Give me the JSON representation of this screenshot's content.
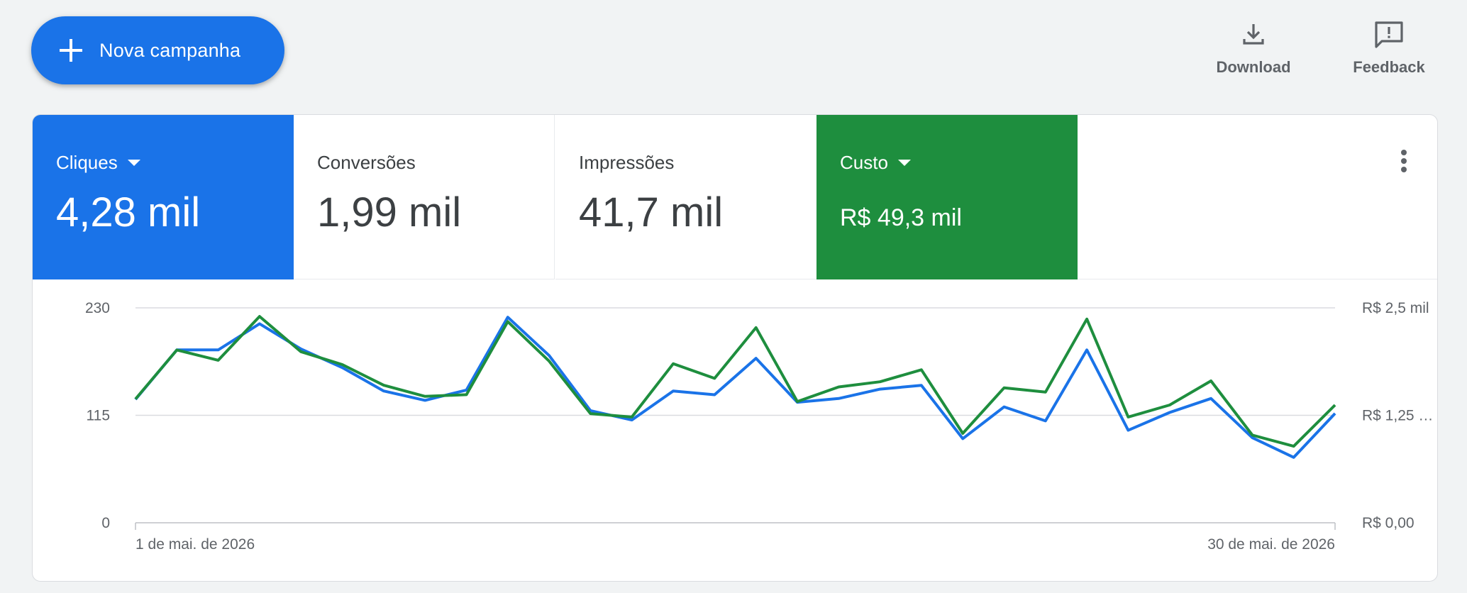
{
  "toolbar": {
    "new_campaign_label": "Nova campanha",
    "download_label": "Download",
    "feedback_label": "Feedback"
  },
  "metrics": [
    {
      "name": "Cliques",
      "value": "4,28 mil",
      "selected": true,
      "color": "#1a73e8"
    },
    {
      "name": "Conversões",
      "value": "1,99 mil",
      "selected": false
    },
    {
      "name": "Impressões",
      "value": "41,7 mil",
      "selected": false
    },
    {
      "name": "Custo",
      "value": "R$ 49,3 mil",
      "selected": true,
      "color": "#1e8e3e"
    }
  ],
  "colors": {
    "accent": "#1a73e8",
    "green": "#1e8e3e",
    "grid": "#dadce0",
    "text": "#3c4043",
    "muted": "#5f6368"
  },
  "chart_data": {
    "type": "line",
    "x": [
      "2026-05-01",
      "2026-05-02",
      "2026-05-03",
      "2026-05-04",
      "2026-05-05",
      "2026-05-06",
      "2026-05-07",
      "2026-05-08",
      "2026-05-09",
      "2026-05-10",
      "2026-05-11",
      "2026-05-12",
      "2026-05-13",
      "2026-05-14",
      "2026-05-15",
      "2026-05-16",
      "2026-05-17",
      "2026-05-18",
      "2026-05-19",
      "2026-05-20",
      "2026-05-21",
      "2026-05-22",
      "2026-05-23",
      "2026-05-24",
      "2026-05-25",
      "2026-05-26",
      "2026-05-27",
      "2026-05-28",
      "2026-05-29",
      "2026-05-30"
    ],
    "x_tick_labels": [
      "1 de mai. de 2026",
      "30 de mai. de 2026"
    ],
    "y_left": {
      "ticks": [
        0,
        115,
        230
      ],
      "tick_labels": [
        "0",
        "115",
        "230"
      ],
      "range": [
        0,
        230
      ]
    },
    "y_right": {
      "ticks": [
        0,
        1.25,
        2.5
      ],
      "tick_labels": [
        "R$ 0,00",
        "R$ 1,25 …",
        "R$ 2,5 mil"
      ],
      "range": [
        0,
        2.5
      ],
      "unit": "mil R$"
    },
    "grid": true,
    "series": [
      {
        "name": "Cliques",
        "axis": "left",
        "color": "#1a73e8",
        "values": [
          132,
          185,
          185,
          213,
          186,
          166,
          141,
          131,
          142,
          220,
          179,
          120,
          110,
          141,
          137,
          176,
          129,
          133,
          143,
          147,
          90,
          124,
          109,
          185,
          99,
          118,
          133,
          91,
          70,
          117
        ]
      },
      {
        "name": "Custo",
        "axis": "right",
        "color": "#1e8e3e",
        "values": [
          1.44,
          2.01,
          1.89,
          2.4,
          1.99,
          1.84,
          1.6,
          1.47,
          1.49,
          2.34,
          1.88,
          1.27,
          1.23,
          1.85,
          1.68,
          2.27,
          1.41,
          1.58,
          1.64,
          1.78,
          1.04,
          1.57,
          1.52,
          2.37,
          1.23,
          1.37,
          1.65,
          1.02,
          0.89,
          1.37
        ]
      }
    ]
  }
}
